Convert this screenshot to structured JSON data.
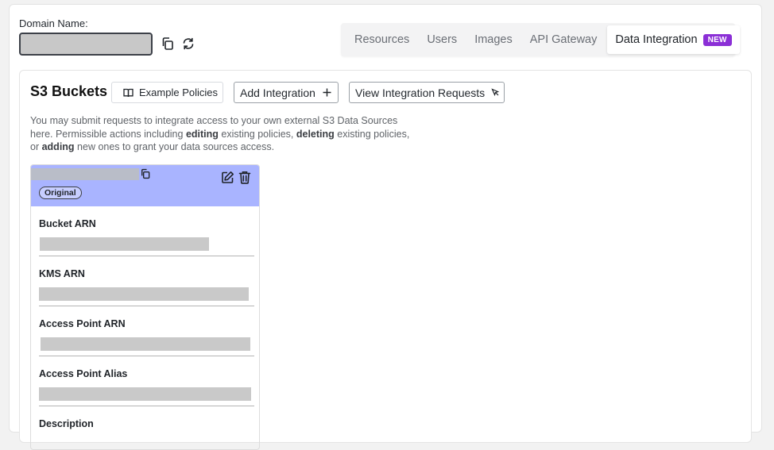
{
  "header": {
    "domain_label": "Domain Name:"
  },
  "tabs": [
    {
      "label": "Resources"
    },
    {
      "label": "Users"
    },
    {
      "label": "Images"
    },
    {
      "label": "API Gateway"
    },
    {
      "label": "Data Integration",
      "badge": "NEW",
      "active": true
    }
  ],
  "panel": {
    "title": "S3 Buckets",
    "example_policies_label": "Example Policies",
    "add_integration_label": "Add Integration",
    "view_requests_label": "View Integration Requests",
    "description": {
      "part1": "You may submit requests to integrate access to your own external S3 Data Sources here. Permissible actions including ",
      "bold1": "editing",
      "part2": " existing policies, ",
      "bold2": "deleting",
      "part3": " existing policies, or ",
      "bold3": "adding",
      "part4": " new ones to grant your data sources access."
    }
  },
  "card": {
    "badge": "Original",
    "fields": [
      {
        "label": "Bucket ARN"
      },
      {
        "label": "KMS ARN"
      },
      {
        "label": "Access Point ARN"
      },
      {
        "label": "Access Point Alias"
      },
      {
        "label": "Description"
      }
    ]
  },
  "colors": {
    "accent_badge": "#8b2fd6",
    "card_header": "#a9b4ff"
  }
}
